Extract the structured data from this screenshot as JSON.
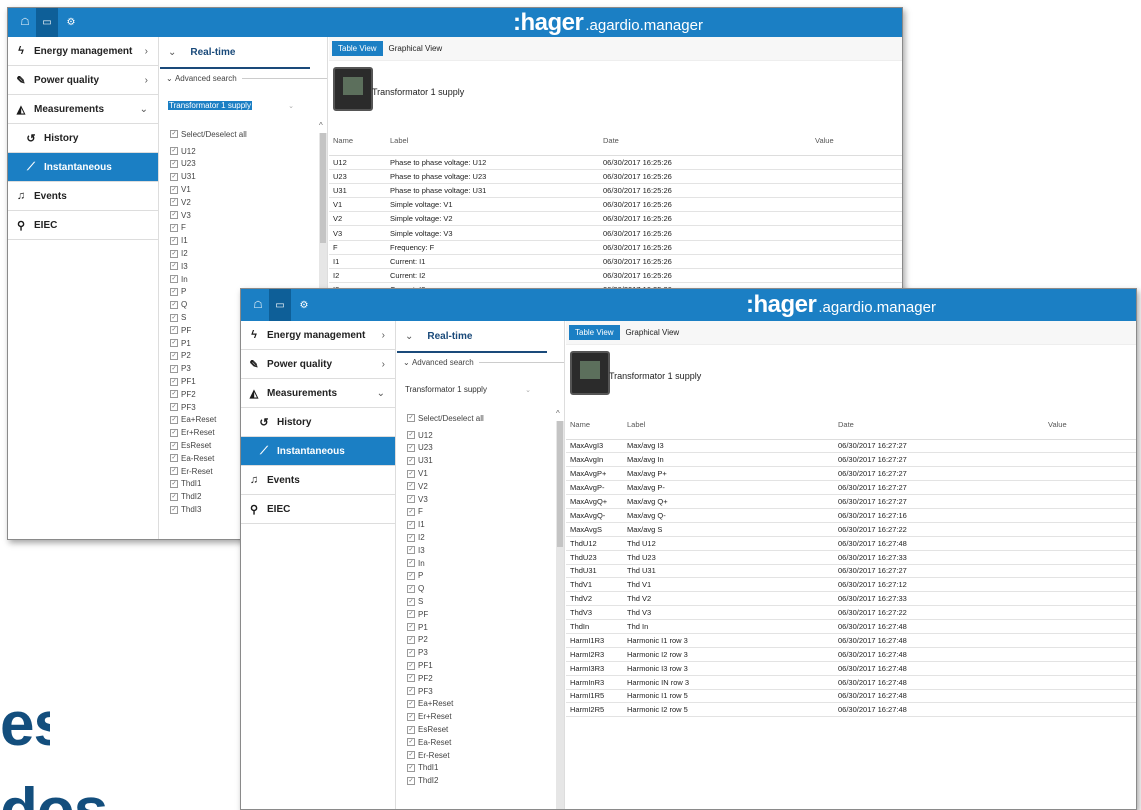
{
  "app": {
    "brand": ":hager",
    "product": ".agardio.manager"
  },
  "icons": {
    "home": "home-icon",
    "screen": "monitor-icon",
    "settings": "gears-icon"
  },
  "nav": [
    {
      "label": "Energy management",
      "icon": "bolt-icon",
      "chevron": "›"
    },
    {
      "label": "Power quality",
      "icon": "plug-icon",
      "chevron": "›"
    },
    {
      "label": "Measurements",
      "icon": "area-chart-icon",
      "chevron": "⌄"
    },
    {
      "label": "History",
      "icon": "history-icon"
    },
    {
      "label": "Instantaneous",
      "icon": "line-chart-icon"
    },
    {
      "label": "Events",
      "icon": "bell-icon"
    },
    {
      "label": "EIEC",
      "icon": "sitemap-icon"
    }
  ],
  "filter": {
    "realtime": "Real-time",
    "advanced": "Advanced search",
    "device": "Transformator 1 supply",
    "select_all": "Select/Deselect all",
    "items_back": [
      "U12",
      "U23",
      "U31",
      "V1",
      "V2",
      "V3",
      "F",
      "I1",
      "I2",
      "I3",
      "In",
      "P",
      "Q",
      "S",
      "PF",
      "P1",
      "P2",
      "P3",
      "PF1",
      "PF2",
      "PF3",
      "Ea+Reset",
      "Er+Reset",
      "EsReset",
      "Ea-Reset",
      "Er-Reset",
      "ThdI1",
      "ThdI2",
      "ThdI3"
    ],
    "items_front": [
      "U12",
      "U23",
      "U31",
      "V1",
      "V2",
      "V3",
      "F",
      "I1",
      "I2",
      "I3",
      "In",
      "P",
      "Q",
      "S",
      "PF",
      "P1",
      "P2",
      "P3",
      "PF1",
      "PF2",
      "PF3",
      "Ea+Reset",
      "Er+Reset",
      "EsReset",
      "Ea-Reset",
      "Er-Reset",
      "ThdI1",
      "ThdI2"
    ]
  },
  "tabs": {
    "table": "Table View",
    "graph": "Graphical View"
  },
  "device_title": "Transformator 1 supply",
  "columns": {
    "name": "Name",
    "label": "Label",
    "date": "Date",
    "value": "Value"
  },
  "rows_back": [
    {
      "name": "U12",
      "label": "Phase to phase voltage: U12",
      "date": "06/30/2017 16:25:26"
    },
    {
      "name": "U23",
      "label": "Phase to phase voltage: U23",
      "date": "06/30/2017 16:25:26"
    },
    {
      "name": "U31",
      "label": "Phase to phase voltage: U31",
      "date": "06/30/2017 16:25:26"
    },
    {
      "name": "V1",
      "label": "Simple voltage: V1",
      "date": "06/30/2017 16:25:26"
    },
    {
      "name": "V2",
      "label": "Simple voltage: V2",
      "date": "06/30/2017 16:25:26"
    },
    {
      "name": "V3",
      "label": "Simple voltage: V3",
      "date": "06/30/2017 16:25:26"
    },
    {
      "name": "F",
      "label": "Frequency: F",
      "date": "06/30/2017 16:25:26"
    },
    {
      "name": "I1",
      "label": "Current: I1",
      "date": "06/30/2017 16:25:26"
    },
    {
      "name": "I2",
      "label": "Current: I2",
      "date": "06/30/2017 16:25:26"
    },
    {
      "name": "I3",
      "label": "Current: I3",
      "date": "06/30/2017 16:25:26"
    },
    {
      "name": "In",
      "label": "Neutral current: In",
      "date": "06/30/2017 16:25:26"
    }
  ],
  "rows_front": [
    {
      "name": "MaxAvgI3",
      "label": "Max/avg I3",
      "date": "06/30/2017 16:27:27"
    },
    {
      "name": "MaxAvgIn",
      "label": "Max/avg In",
      "date": "06/30/2017 16:27:27"
    },
    {
      "name": "MaxAvgP+",
      "label": "Max/avg P+",
      "date": "06/30/2017 16:27:27"
    },
    {
      "name": "MaxAvgP-",
      "label": "Max/avg P-",
      "date": "06/30/2017 16:27:27"
    },
    {
      "name": "MaxAvgQ+",
      "label": "Max/avg Q+",
      "date": "06/30/2017 16:27:27"
    },
    {
      "name": "MaxAvgQ-",
      "label": "Max/avg Q-",
      "date": "06/30/2017 16:27:16"
    },
    {
      "name": "MaxAvgS",
      "label": "Max/avg S",
      "date": "06/30/2017 16:27:22"
    },
    {
      "name": "ThdU12",
      "label": "Thd U12",
      "date": "06/30/2017 16:27:48"
    },
    {
      "name": "ThdU23",
      "label": "Thd U23",
      "date": "06/30/2017 16:27:33"
    },
    {
      "name": "ThdU31",
      "label": "Thd U31",
      "date": "06/30/2017 16:27:27"
    },
    {
      "name": "ThdV1",
      "label": "Thd V1",
      "date": "06/30/2017 16:27:12"
    },
    {
      "name": "ThdV2",
      "label": "Thd V2",
      "date": "06/30/2017 16:27:33"
    },
    {
      "name": "ThdV3",
      "label": "Thd V3",
      "date": "06/30/2017 16:27:22"
    },
    {
      "name": "ThdIn",
      "label": "Thd In",
      "date": "06/30/2017 16:27:48"
    },
    {
      "name": "HarmI1R3",
      "label": "Harmonic I1 row 3",
      "date": "06/30/2017 16:27:48"
    },
    {
      "name": "HarmI2R3",
      "label": "Harmonic I2 row 3",
      "date": "06/30/2017 16:27:48"
    },
    {
      "name": "HarmI3R3",
      "label": "Harmonic I3 row 3",
      "date": "06/30/2017 16:27:48"
    },
    {
      "name": "HarmInR3",
      "label": "Harmonic IN row 3",
      "date": "06/30/2017 16:27:48"
    },
    {
      "name": "HarmI1R5",
      "label": "Harmonic I1 row 5",
      "date": "06/30/2017 16:27:48"
    },
    {
      "name": "HarmI2R5",
      "label": "Harmonic I2 row 5",
      "date": "06/30/2017 16:27:48"
    }
  ],
  "brand_text": {
    "line1": "es",
    "line2": "dos"
  },
  "colors": {
    "accent": "#1b7fc4",
    "accent_dark": "#0e5f98",
    "brand_navy": "#134e7d"
  }
}
